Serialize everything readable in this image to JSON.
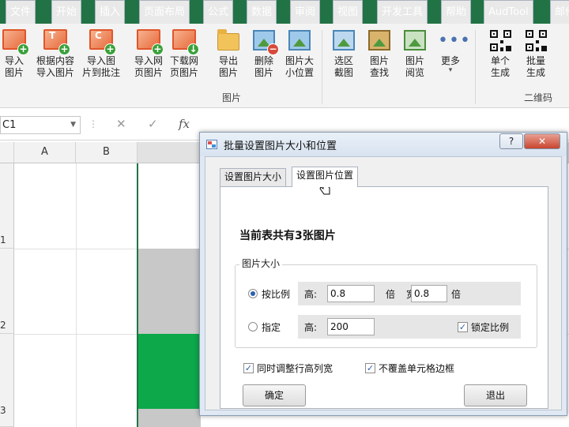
{
  "menu": {
    "tabs": [
      "文件",
      "开始",
      "插入",
      "页面布局",
      "公式",
      "数据",
      "审阅",
      "视图",
      "开发工具",
      "帮助",
      "AudTool",
      "邮件"
    ]
  },
  "ribbon": {
    "buttons": [
      {
        "l1": "导入",
        "l2": "图片"
      },
      {
        "l1": "根据内容",
        "l2": "导入图片"
      },
      {
        "l1": "导入图",
        "l2": "片到批注"
      },
      {
        "l1": "导入网",
        "l2": "页图片"
      },
      {
        "l1": "下载网",
        "l2": "页图片"
      },
      {
        "l1": "导出",
        "l2": "图片"
      },
      {
        "l1": "删除",
        "l2": "图片"
      },
      {
        "l1": "图片大",
        "l2": "小位置"
      },
      {
        "l1": "选区",
        "l2": "截图"
      },
      {
        "l1": "图片",
        "l2": "查找"
      },
      {
        "l1": "图片",
        "l2": "阅览"
      },
      {
        "l1": "更多",
        "l2": ""
      },
      {
        "l1": "单个",
        "l2": "生成"
      },
      {
        "l1": "批量",
        "l2": "生成"
      }
    ],
    "group_picture": "图片",
    "group_qrcode": "二维码"
  },
  "formula_bar": {
    "name_box": "C1",
    "cancel_symbol": "✕",
    "enter_symbol": "✓",
    "fx_symbol": "fx"
  },
  "sheet": {
    "columns": [
      "A",
      "B"
    ],
    "rows": [
      "1",
      "2",
      "3"
    ],
    "colors": {
      "selected_green": "#0ca84a",
      "gray_fill": "#c8c8c8"
    }
  },
  "dialog": {
    "title": "批量设置图片大小和位置",
    "help": "?",
    "close": "✕",
    "tabs": [
      "设置图片大小",
      "设置图片位置"
    ],
    "heading": "当前表共有3张图片",
    "group_title": "图片大小",
    "ratio_label": "按比例",
    "height_label": "高:",
    "height_ratio": "0.8",
    "times_label": "倍",
    "width_label": "宽:",
    "width_ratio": "0.8",
    "specify_label": "指定",
    "height_value": "200",
    "lock_ratio_label": "锁定比例",
    "adjust_rowcol_label": "同时调整行高列宽",
    "no_cover_label": "不覆盖单元格边框",
    "ok_button": "确定",
    "exit_button": "退出"
  }
}
